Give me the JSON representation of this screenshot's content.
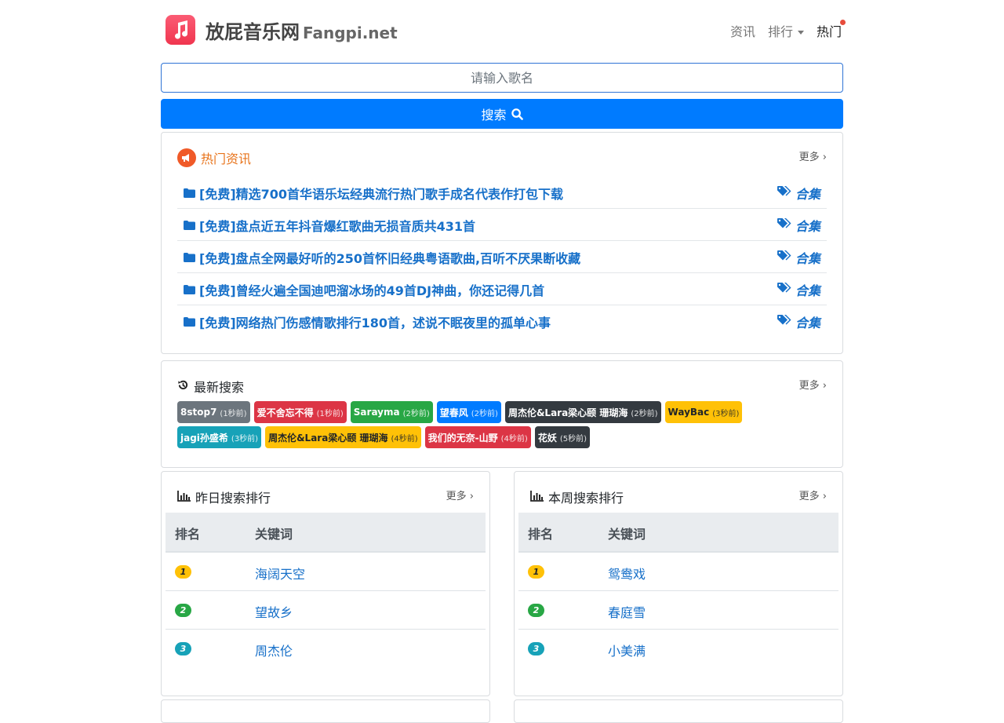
{
  "header": {
    "brand_cn": "放屁音乐网",
    "brand_en": "Fangpi.net",
    "nav": {
      "news": "资讯",
      "rank": "排行",
      "hot": "热门"
    }
  },
  "search": {
    "placeholder": "请输入歌名",
    "button": "搜索"
  },
  "hot_news": {
    "title": "热门资讯",
    "more": "更多",
    "items": [
      {
        "title": "[免费]精选700首华语乐坛经典流行热门歌手成名代表作打包下载",
        "tag": "合集"
      },
      {
        "title": "[免费]盘点近五年抖音爆红歌曲无损音质共431首",
        "tag": "合集"
      },
      {
        "title": "[免费]盘点全网最好听的250首怀旧经典粤语歌曲,百听不厌果断收藏",
        "tag": "合集"
      },
      {
        "title": "[免费]曾经火遍全国迪吧溜冰场的49首DJ神曲，你还记得几首",
        "tag": "合集"
      },
      {
        "title": "[免费]网络热门伤感情歌排行180首，述说不眠夜里的孤单心事",
        "tag": "合集"
      }
    ]
  },
  "latest_search": {
    "title": "最新搜索",
    "more": "更多",
    "items": [
      {
        "text": "8stop7",
        "time": "(1秒前)",
        "color": "#6c757d",
        "fg": "#ffffff"
      },
      {
        "text": "爱不舍忘不得",
        "time": "(1秒前)",
        "color": "#dc3545",
        "fg": "#ffffff"
      },
      {
        "text": "Sarayma",
        "time": "(2秒前)",
        "color": "#28a745",
        "fg": "#ffffff"
      },
      {
        "text": "望春风",
        "time": "(2秒前)",
        "color": "#007bff",
        "fg": "#ffffff"
      },
      {
        "text": "周杰伦&Lara梁心颐 珊瑚海",
        "time": "(2秒前)",
        "color": "#343a40",
        "fg": "#ffffff"
      },
      {
        "text": "WayBac",
        "time": "(3秒前)",
        "color": "#ffc107",
        "fg": "#212529"
      },
      {
        "text": "jagi孙盛希",
        "time": "(3秒前)",
        "color": "#17a2b8",
        "fg": "#ffffff"
      },
      {
        "text": "周杰伦&Lara梁心颐 珊瑚海",
        "time": "(4秒前)",
        "color": "#ffc107",
        "fg": "#212529"
      },
      {
        "text": "我们的无奈-山野",
        "time": "(4秒前)",
        "color": "#dc3545",
        "fg": "#ffffff"
      },
      {
        "text": "花妖",
        "time": "(5秒前)",
        "color": "#343a40",
        "fg": "#ffffff"
      }
    ]
  },
  "yesterday_rank": {
    "title": "昨日搜索排行",
    "more": "更多",
    "col_rank": "排名",
    "col_keyword": "关键词",
    "rows": [
      {
        "rank": "1",
        "keyword": "海阔天空"
      },
      {
        "rank": "2",
        "keyword": "望故乡"
      },
      {
        "rank": "3",
        "keyword": "周杰伦"
      }
    ]
  },
  "week_rank": {
    "title": "本周搜索排行",
    "more": "更多",
    "col_rank": "排名",
    "col_keyword": "关键词",
    "rows": [
      {
        "rank": "1",
        "keyword": "鸳鸯戏"
      },
      {
        "rank": "2",
        "keyword": "春庭雪"
      },
      {
        "rank": "3",
        "keyword": "小美满"
      }
    ]
  },
  "colors": {
    "primary": "#007bff",
    "link": "#1770c9",
    "hot_orange": "#e8741c",
    "rank1": "#ffc107",
    "rank2": "#28a745",
    "rank3": "#17a2b8"
  }
}
